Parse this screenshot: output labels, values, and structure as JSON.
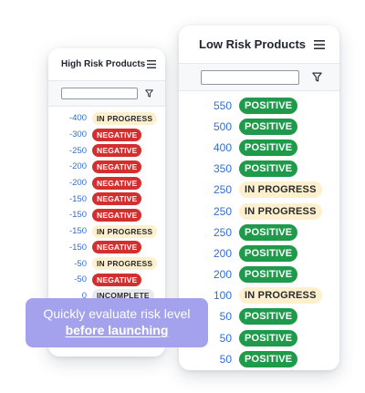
{
  "left_panel": {
    "title": "High Risk Products",
    "filter_placeholder": "",
    "rows": [
      {
        "value": "-400",
        "status": "IN PROGRESS",
        "kind": "in_progress"
      },
      {
        "value": "-300",
        "status": "NEGATIVE",
        "kind": "negative"
      },
      {
        "value": "-250",
        "status": "NEGATIVE",
        "kind": "negative"
      },
      {
        "value": "-200",
        "status": "NEGATIVE",
        "kind": "negative"
      },
      {
        "value": "-200",
        "status": "NEGATIVE",
        "kind": "negative"
      },
      {
        "value": "-150",
        "status": "NEGATIVE",
        "kind": "negative"
      },
      {
        "value": "-150",
        "status": "NEGATIVE",
        "kind": "negative"
      },
      {
        "value": "-150",
        "status": "IN PROGRESS",
        "kind": "in_progress"
      },
      {
        "value": "-150",
        "status": "NEGATIVE",
        "kind": "negative"
      },
      {
        "value": "-50",
        "status": "IN PROGRESS",
        "kind": "in_progress"
      },
      {
        "value": "-50",
        "status": "NEGATIVE",
        "kind": "negative"
      },
      {
        "value": "0",
        "status": "INCOMPLETE",
        "kind": "incomplete"
      }
    ]
  },
  "right_panel": {
    "title": "Low Risk Products",
    "filter_placeholder": "",
    "rows": [
      {
        "value": "550",
        "status": "POSITIVE",
        "kind": "positive"
      },
      {
        "value": "500",
        "status": "POSITIVE",
        "kind": "positive"
      },
      {
        "value": "400",
        "status": "POSITIVE",
        "kind": "positive"
      },
      {
        "value": "350",
        "status": "POSITIVE",
        "kind": "positive"
      },
      {
        "value": "250",
        "status": "IN PROGRESS",
        "kind": "in_progress"
      },
      {
        "value": "250",
        "status": "IN PROGRESS",
        "kind": "in_progress"
      },
      {
        "value": "250",
        "status": "POSITIVE",
        "kind": "positive"
      },
      {
        "value": "200",
        "status": "POSITIVE",
        "kind": "positive"
      },
      {
        "value": "200",
        "status": "POSITIVE",
        "kind": "positive"
      },
      {
        "value": "100",
        "status": "IN PROGRESS",
        "kind": "in_progress"
      },
      {
        "value": "50",
        "status": "POSITIVE",
        "kind": "positive"
      },
      {
        "value": "50",
        "status": "POSITIVE",
        "kind": "positive"
      },
      {
        "value": "50",
        "status": "POSITIVE",
        "kind": "positive"
      }
    ]
  },
  "callout": {
    "line1": "Quickly evaluate risk level",
    "line2": "before launching"
  },
  "icons": {
    "menu": "menu-icon",
    "filter": "filter-icon"
  },
  "colors": {
    "value_text": "#2f6fd6",
    "positive": "#1f9a4a",
    "negative": "#d42f2f",
    "in_progress": "#fdf0cf",
    "incomplete": "#e9eaee",
    "callout_bg": "#a4a2ec"
  }
}
